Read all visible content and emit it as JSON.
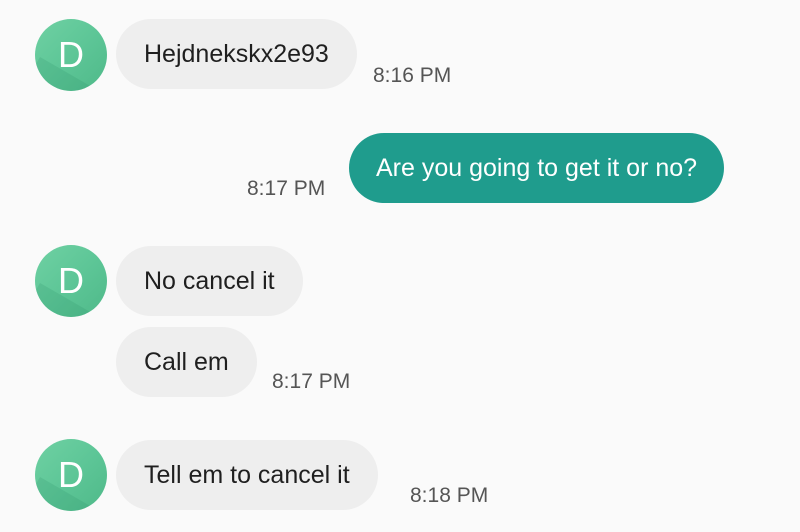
{
  "contact": {
    "initial": "D",
    "avatar_color": "#5cc596"
  },
  "colors": {
    "incoming_bubble": "#eeeeee",
    "outgoing_bubble": "#1f9c8d",
    "background": "#fafafa"
  },
  "messages": [
    {
      "direction": "incoming",
      "text": "Hejdnekskx2e93",
      "time": "8:16 PM"
    },
    {
      "direction": "outgoing",
      "text": "Are you going to get it or no?",
      "time": "8:17 PM"
    },
    {
      "direction": "incoming",
      "text": "No cancel it",
      "time": ""
    },
    {
      "direction": "incoming",
      "text": "Call em",
      "time": "8:17 PM"
    },
    {
      "direction": "incoming",
      "text": "Tell em to cancel it",
      "time": "8:18 PM"
    }
  ]
}
